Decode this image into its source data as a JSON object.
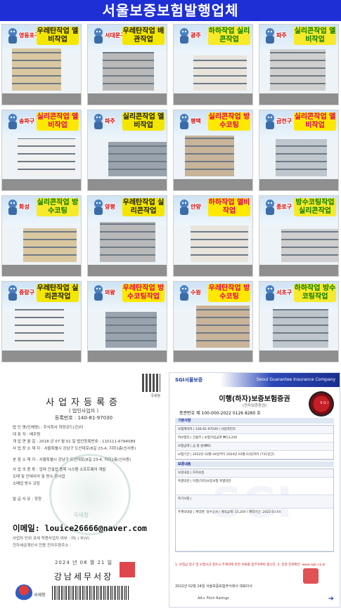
{
  "banner": {
    "title": "서울보증보험발행업체"
  },
  "tiles": [
    {
      "location": "영등포구",
      "work": "우레탄작업 엘비작업",
      "style": "w1"
    },
    {
      "location": "서대문구",
      "work": "우레탄작업 배관작업",
      "style": "w1"
    },
    {
      "location": "광주",
      "work": "하하작업 실리콘작업",
      "style": "w2"
    },
    {
      "location": "파주",
      "work": "실리콘작업 엘비작업",
      "style": "w2"
    },
    {
      "location": "송파구",
      "work": "실리콘작업 엘비작업",
      "style": "w3"
    },
    {
      "location": "파주",
      "work": "실리콘작업 엘비작업",
      "style": "w1"
    },
    {
      "location": "평택",
      "work": "실리콘작업 방수코팅",
      "style": "w3"
    },
    {
      "location": "금천구",
      "work": "실리콘작업 엘비작업",
      "style": "w3"
    },
    {
      "location": "화성",
      "work": "실리콘작업 방수코팅",
      "style": "w2"
    },
    {
      "location": "양평",
      "work": "우레탄작업 실리콘작업",
      "style": "w1"
    },
    {
      "location": "안양",
      "work": "하하작업 엘비작업",
      "style": "w3"
    },
    {
      "location": "종로구",
      "work": "방수코팅작업 실리콘작업",
      "style": "w2"
    },
    {
      "location": "중랑구",
      "work": "우레탄작업 실리콘작업",
      "style": "w1"
    },
    {
      "location": "의왕",
      "work": "우레탄작업 방수코팅작업",
      "style": "w3"
    },
    {
      "location": "수원",
      "work": "우레탄작업 방수코팅",
      "style": "w3"
    },
    {
      "location": "서초구",
      "work": "하하작업 방수코팅작업",
      "style": "w2"
    }
  ],
  "business_cert": {
    "qr_label": "국세청",
    "title": "사업자등록증",
    "subtitle": "( 법인사업자 )",
    "reg_no": "등록번호 : 140-81-97030",
    "rows": [
      "법 인 명(단체명) : 주식회사 하양코드(건)터",
      "대      표      자 : 배주원",
      "개 업 연 월 일 : 2018 년 07 월 01 일     법인등록번호 : 110111-6794089",
      "사 업 장 소 재 지 : 서울특별시 강남구 도산대로(8길 23-4, 지하1층(신사동)",
      "본 점 소 재 지 : 서울특별시 강남구 도산대로(8길 23-4, 지하1층(신사동)",
      "사 업 의 종 류 : 업태  건설업   종목  시스템 소프트웨어 개발",
      "                    도매 및  인테리어 및 방수 공사업",
      "                    소매업   방수 코팅",
      "발 급 사 유 : 정정"
    ],
    "seal_text": "국세청",
    "email": "이메일: louice26666@naver.com",
    "notes": [
      "사업자 단위 과세 적용사업자 여부 : 여( ) 부(V)",
      "전자세금계산서 전용 전자우편주소 :"
    ],
    "date": "2024 년 08 월 21 일",
    "office": "강남세무서장",
    "nts_label": "국세청"
  },
  "insurance_cert": {
    "logo": "SGI서울보증",
    "eng_name": "Seoul Guarantee Insurance Company",
    "title": "이행(하자)보증보험증권",
    "subtitle": "(전자보증증권)",
    "cert_no": "증권번호 제 100-000-2022 0126 8280 호",
    "badge_text": "S G I",
    "sections": [
      {
        "label": "기본사항",
        "rows": [
          "보험계약자 | 140-81-97030 | 사업자번호",
          "피보험자 | 건물주 | 보험가입금액 ₩13,200",
          "보험금액 | 금 칠 원(₩0)",
          "보험기간 | 2022년 03월 04일부터 2024년 03월 03일까지 (731일간)"
        ]
      },
      {
        "label": "보증내용",
        "rows": [
          "보증내용 | 하자보증",
          "특별약관 | 이행(하자)보증보험 특별약관",
          "특기사항 |",
          "주계약내용 | 계약명: 방수공사 / 계약금액: 13,200 / 계약기간: 2022.03.04"
        ]
      }
    ],
    "watermark": "SGI",
    "warning": "1. 보험금 청구 및 보험사고 접수시 주계약에 관한 서류를 첨부하여야 합니다. 2. 증권 진위확인: www.sgic.co.kr",
    "footer": "2022년 02월 24일   서울보증보험주식회사   대표이사",
    "ratings": "AA+  Fitch Ratings"
  }
}
